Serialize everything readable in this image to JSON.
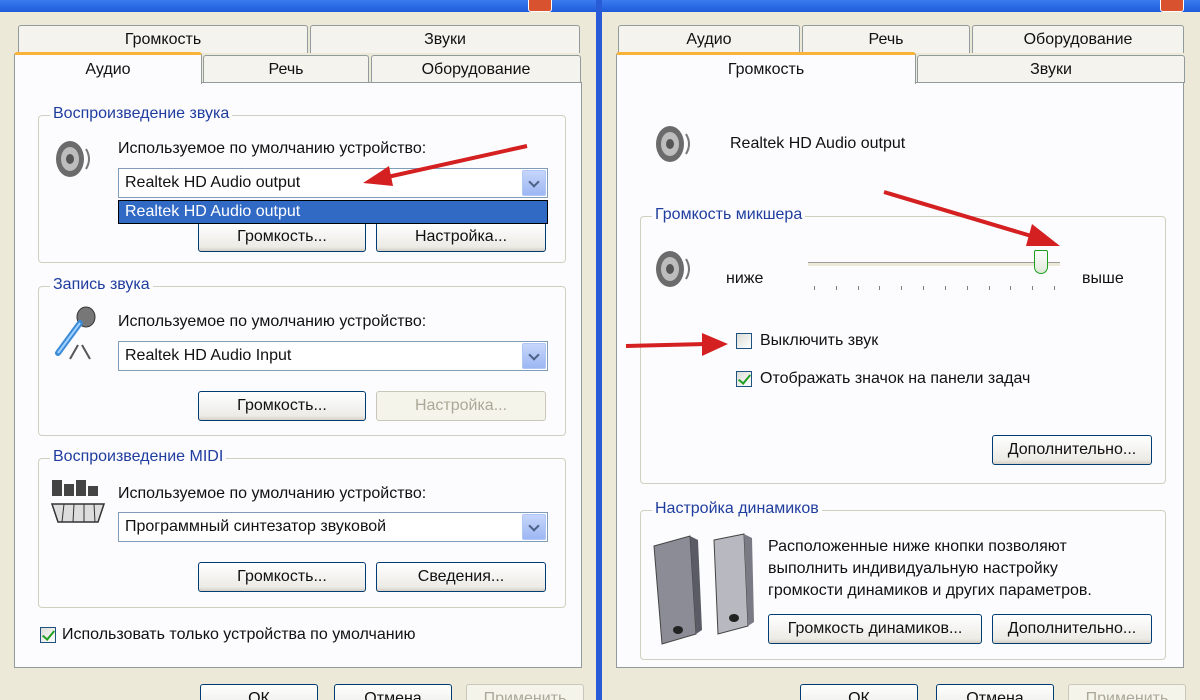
{
  "left_dialog": {
    "tabs_back": [
      "Громкость",
      "Звуки"
    ],
    "tabs_front": [
      "Аудио",
      "Речь",
      "Оборудование"
    ],
    "playback": {
      "group_label": "Воспроизведение звука",
      "device_label": "Используемое по умолчанию устройство:",
      "device_value": "Realtek HD Audio output",
      "dropdown_item": "Realtek HD Audio output",
      "volume_button": "Громкость...",
      "settings_button": "Настройка..."
    },
    "recording": {
      "group_label": "Запись звука",
      "device_label": "Используемое по умолчанию устройство:",
      "device_value": "Realtek HD Audio Input",
      "volume_button": "Громкость...",
      "settings_button": "Настройка..."
    },
    "midi": {
      "group_label": "Воспроизведение MIDI",
      "device_label": "Используемое по умолчанию устройство:",
      "device_value": "Программный синтезатор звуковой",
      "volume_button": "Громкость...",
      "info_button": "Сведения..."
    },
    "use_default_only": {
      "label": "Использовать только устройства по умолчанию",
      "checked": true
    },
    "footer_buttons": [
      "ОК",
      "Отмена",
      "Применить"
    ]
  },
  "right_dialog": {
    "tabs_back": [
      "Аудио",
      "Речь",
      "Оборудование"
    ],
    "tabs_front": [
      "Громкость",
      "Звуки"
    ],
    "device_name": "Realtek HD Audio output",
    "mixer": {
      "group_label": "Громкость микшера",
      "low_label": "ниже",
      "high_label": "выше",
      "volume_level": 0.95,
      "mute": {
        "label": "Выключить звук",
        "checked": false
      },
      "tray_icon": {
        "label": "Отображать значок на панели задач",
        "checked": true
      },
      "advanced_button": "Дополнительно..."
    },
    "speakers": {
      "group_label": "Настройка динамиков",
      "description_lines": [
        "Расположенные ниже кнопки позволяют",
        "выполнить индивидуальную настройку",
        "громкости динамиков и других параметров."
      ],
      "speaker_volume_button": "Громкость динамиков...",
      "advanced_button": "Дополнительно..."
    },
    "footer_buttons": [
      "ОК",
      "Отмена",
      "Применить"
    ]
  },
  "colors": {
    "annotation_arrow": "#d42020",
    "selection": "#316ac5",
    "active_tab_accent": "#f9b33b",
    "group_label_text": "#1f3d9e"
  }
}
